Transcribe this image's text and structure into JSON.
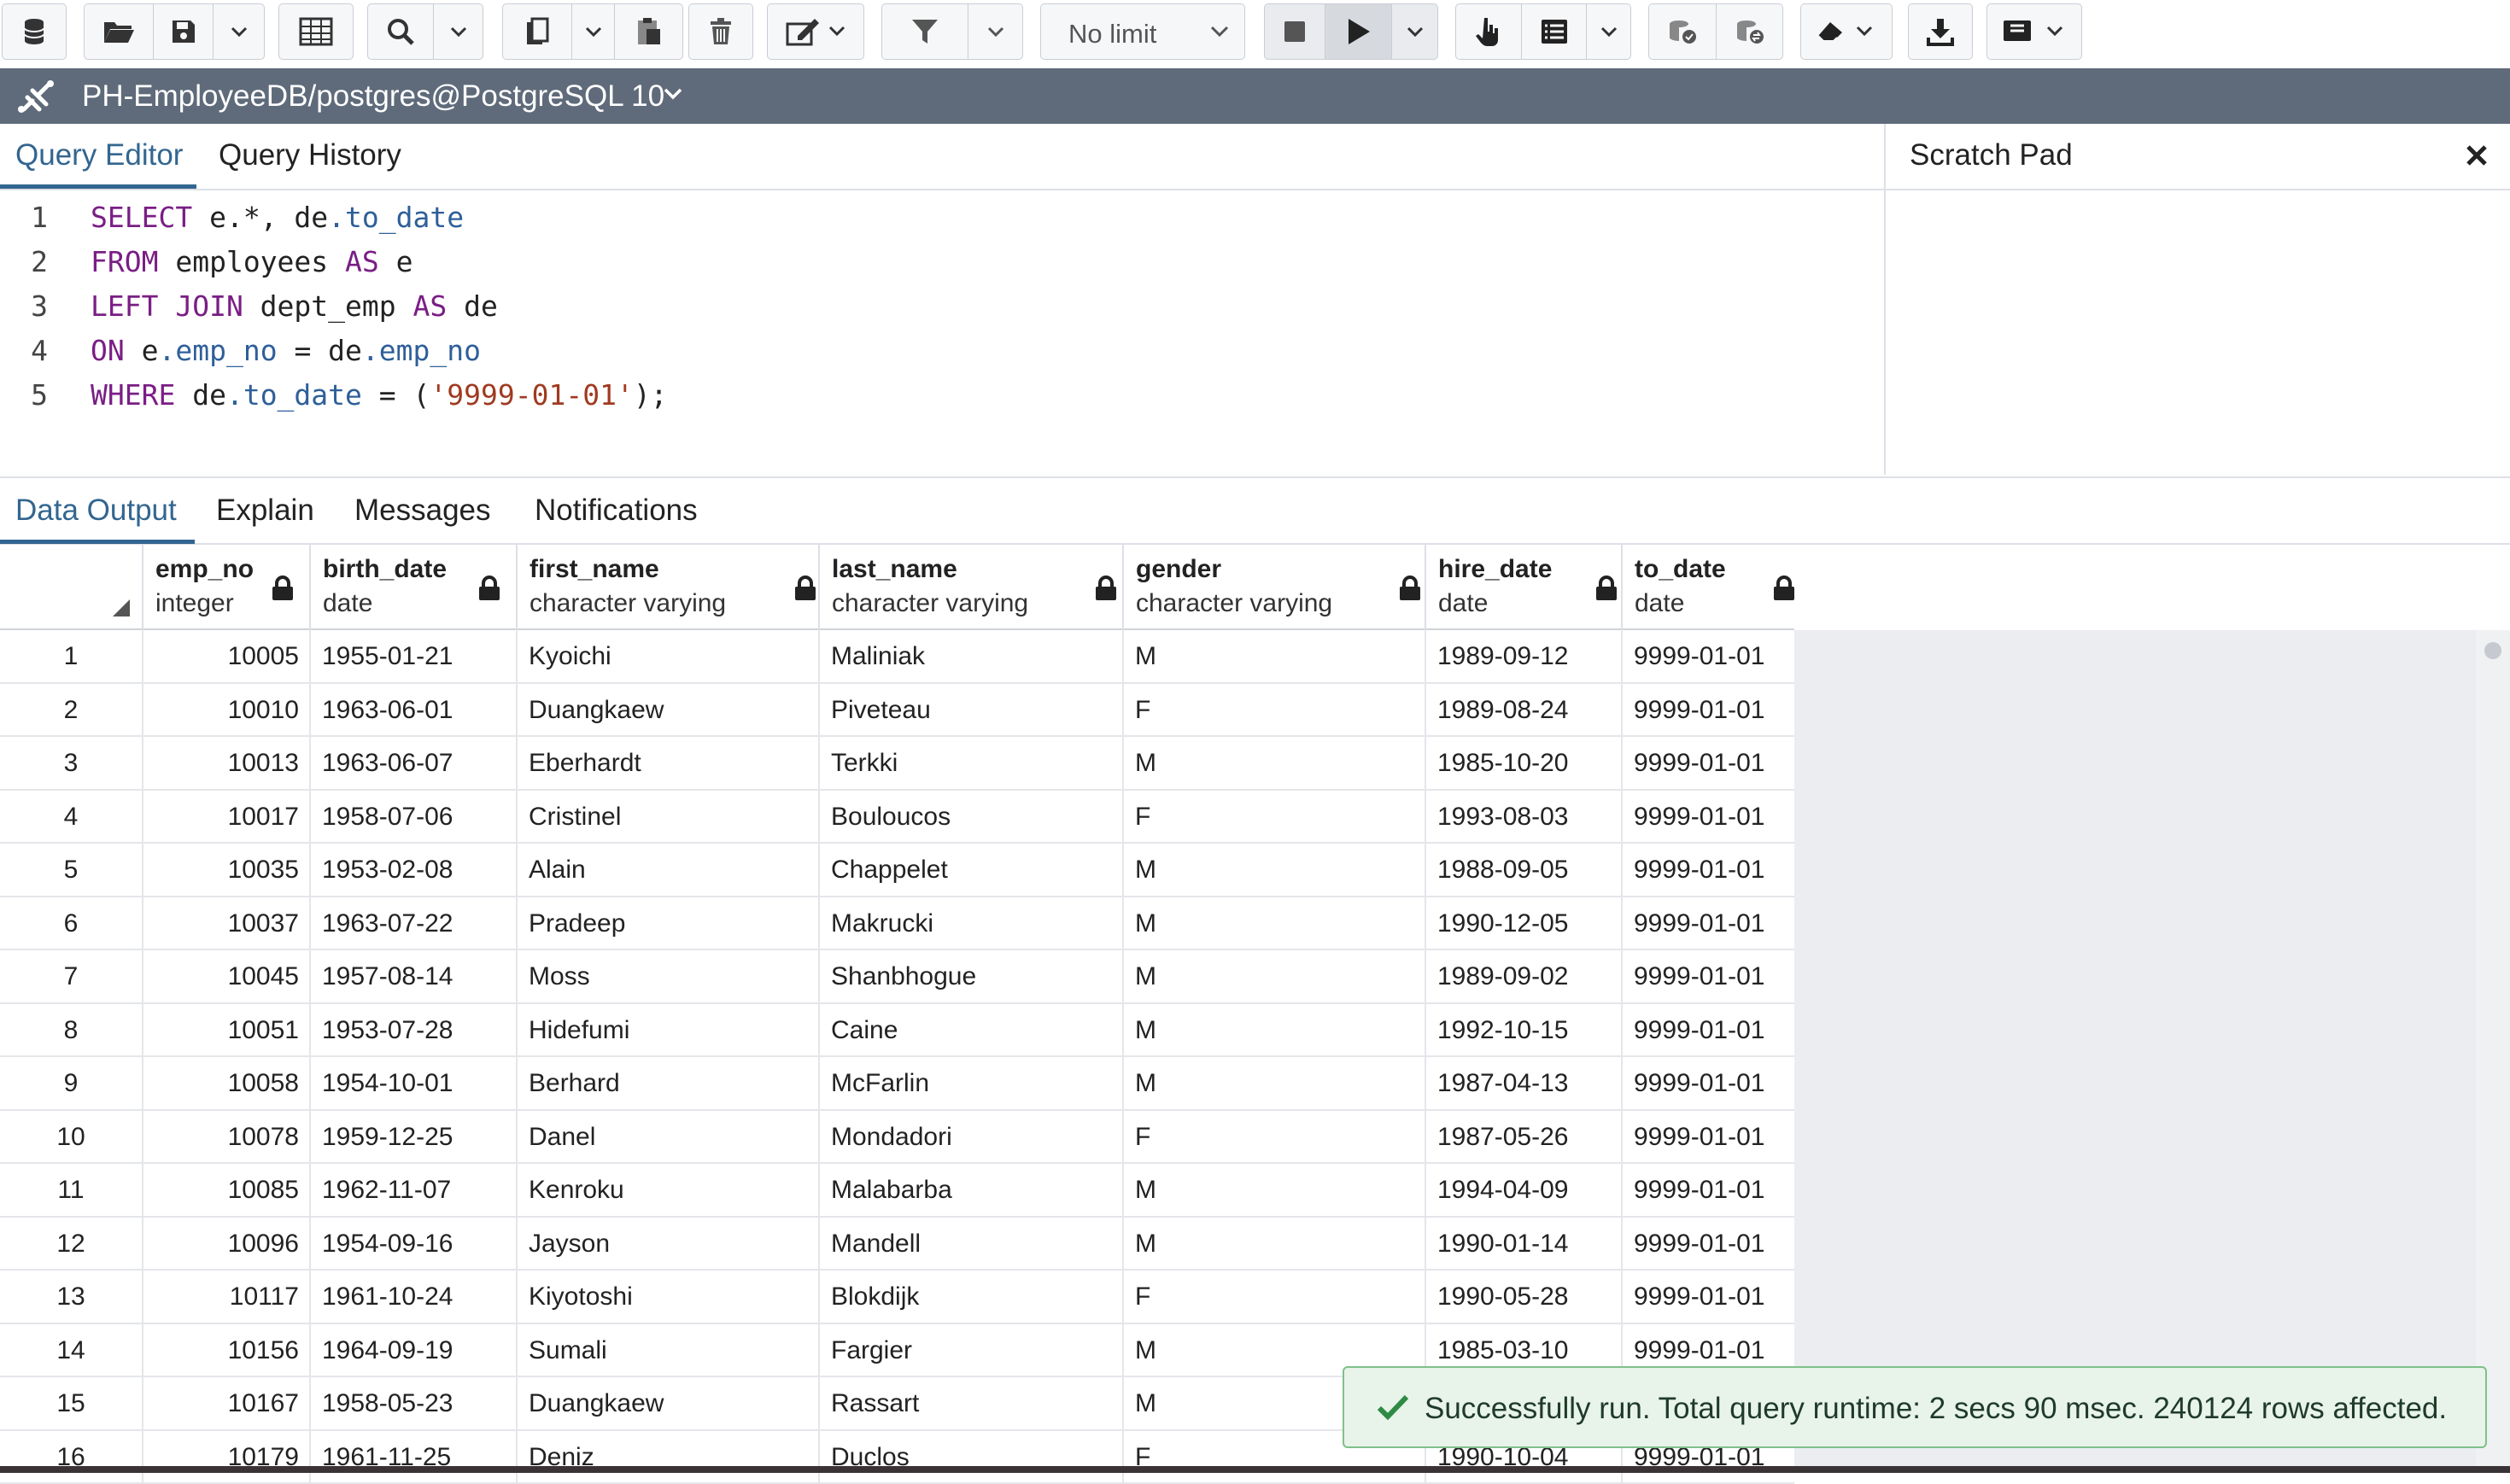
{
  "toolbar": {
    "buttons": [
      {
        "name": "database-icon"
      },
      {
        "name": "open-file-icon"
      },
      {
        "name": "save-icon"
      },
      {
        "name": "save-options-chevron-down-icon"
      },
      {
        "name": "edit-data-grid-icon"
      },
      {
        "name": "find-icon"
      },
      {
        "name": "find-options-chevron-down-icon"
      },
      {
        "name": "copy-icon"
      },
      {
        "name": "copy-options-chevron-down-icon"
      },
      {
        "name": "paste-icon"
      },
      {
        "name": "delete-icon"
      },
      {
        "name": "edit-pencil-icon"
      },
      {
        "name": "filter-icon"
      },
      {
        "name": "filter-options-chevron-down-icon"
      },
      {
        "name": "stop-icon"
      },
      {
        "name": "execute-play-icon"
      },
      {
        "name": "execute-options-chevron-down-icon"
      },
      {
        "name": "explain-hand-icon"
      },
      {
        "name": "explain-analyze-list-icon"
      },
      {
        "name": "explain-options-chevron-down-icon"
      },
      {
        "name": "commit-icon"
      },
      {
        "name": "rollback-icon"
      },
      {
        "name": "clear-eraser-icon"
      },
      {
        "name": "download-icon"
      },
      {
        "name": "macros-icon"
      }
    ],
    "limit_label": "No limit"
  },
  "connection": {
    "title": "PH-EmployeeDB/postgres@PostgreSQL 10"
  },
  "editor": {
    "tabs": [
      {
        "label": "Query Editor",
        "active": true
      },
      {
        "label": "Query History",
        "active": false
      }
    ],
    "lines": [
      {
        "number": "1",
        "tokens": [
          {
            "t": "SELECT",
            "k": "kw"
          },
          {
            "t": " e.*, de",
            "k": ""
          },
          {
            "t": ".to_date",
            "k": "prop"
          }
        ]
      },
      {
        "number": "2",
        "tokens": [
          {
            "t": "FROM",
            "k": "kw"
          },
          {
            "t": " employees ",
            "k": ""
          },
          {
            "t": "AS",
            "k": "kw"
          },
          {
            "t": " e",
            "k": ""
          }
        ]
      },
      {
        "number": "3",
        "tokens": [
          {
            "t": "LEFT JOIN",
            "k": "kw"
          },
          {
            "t": " dept_emp ",
            "k": ""
          },
          {
            "t": "AS",
            "k": "kw"
          },
          {
            "t": " de",
            "k": ""
          }
        ]
      },
      {
        "number": "4",
        "tokens": [
          {
            "t": "ON",
            "k": "kw"
          },
          {
            "t": " e",
            "k": ""
          },
          {
            "t": ".emp_no",
            "k": "prop"
          },
          {
            "t": " = de",
            "k": ""
          },
          {
            "t": ".emp_no",
            "k": "prop"
          }
        ]
      },
      {
        "number": "5",
        "tokens": [
          {
            "t": "WHERE",
            "k": "kw"
          },
          {
            "t": " de",
            "k": ""
          },
          {
            "t": ".to_date",
            "k": "prop"
          },
          {
            "t": " = (",
            "k": ""
          },
          {
            "t": "'9999-01-01'",
            "k": "str"
          },
          {
            "t": ");",
            "k": ""
          }
        ]
      }
    ]
  },
  "scratch_pad": {
    "title": "Scratch Pad"
  },
  "output": {
    "tabs": [
      {
        "label": "Data Output",
        "active": true
      },
      {
        "label": "Explain",
        "active": false
      },
      {
        "label": "Messages",
        "active": false
      },
      {
        "label": "Notifications",
        "active": false
      }
    ],
    "columns": [
      {
        "name": "emp_no",
        "type": "integer",
        "align": "num"
      },
      {
        "name": "birth_date",
        "type": "date",
        "align": "txt"
      },
      {
        "name": "first_name",
        "type": "character varying",
        "align": "txt"
      },
      {
        "name": "last_name",
        "type": "character varying",
        "align": "txt"
      },
      {
        "name": "gender",
        "type": "character varying",
        "align": "txt"
      },
      {
        "name": "hire_date",
        "type": "date",
        "align": "txt"
      },
      {
        "name": "to_date",
        "type": "date",
        "align": "txt"
      }
    ],
    "rows": [
      [
        "1",
        "10005",
        "1955-01-21",
        "Kyoichi",
        "Maliniak",
        "M",
        "1989-09-12",
        "9999-01-01"
      ],
      [
        "2",
        "10010",
        "1963-06-01",
        "Duangkaew",
        "Piveteau",
        "F",
        "1989-08-24",
        "9999-01-01"
      ],
      [
        "3",
        "10013",
        "1963-06-07",
        "Eberhardt",
        "Terkki",
        "M",
        "1985-10-20",
        "9999-01-01"
      ],
      [
        "4",
        "10017",
        "1958-07-06",
        "Cristinel",
        "Bouloucos",
        "F",
        "1993-08-03",
        "9999-01-01"
      ],
      [
        "5",
        "10035",
        "1953-02-08",
        "Alain",
        "Chappelet",
        "M",
        "1988-09-05",
        "9999-01-01"
      ],
      [
        "6",
        "10037",
        "1963-07-22",
        "Pradeep",
        "Makrucki",
        "M",
        "1990-12-05",
        "9999-01-01"
      ],
      [
        "7",
        "10045",
        "1957-08-14",
        "Moss",
        "Shanbhogue",
        "M",
        "1989-09-02",
        "9999-01-01"
      ],
      [
        "8",
        "10051",
        "1953-07-28",
        "Hidefumi",
        "Caine",
        "M",
        "1992-10-15",
        "9999-01-01"
      ],
      [
        "9",
        "10058",
        "1954-10-01",
        "Berhard",
        "McFarlin",
        "M",
        "1987-04-13",
        "9999-01-01"
      ],
      [
        "10",
        "10078",
        "1959-12-25",
        "Danel",
        "Mondadori",
        "F",
        "1987-05-26",
        "9999-01-01"
      ],
      [
        "11",
        "10085",
        "1962-11-07",
        "Kenroku",
        "Malabarba",
        "M",
        "1994-04-09",
        "9999-01-01"
      ],
      [
        "12",
        "10096",
        "1954-09-16",
        "Jayson",
        "Mandell",
        "M",
        "1990-01-14",
        "9999-01-01"
      ],
      [
        "13",
        "10117",
        "1961-10-24",
        "Kiyotoshi",
        "Blokdijk",
        "F",
        "1990-05-28",
        "9999-01-01"
      ],
      [
        "14",
        "10156",
        "1964-09-19",
        "Sumali",
        "Fargier",
        "M",
        "1985-03-10",
        "9999-01-01"
      ],
      [
        "15",
        "10167",
        "1958-05-23",
        "Duangkaew",
        "Rassart",
        "M",
        "",
        ""
      ],
      [
        "16",
        "10179",
        "1961-11-25",
        "Deniz",
        "Duclos",
        "F",
        "1990-10-04",
        "9999-01-01"
      ]
    ]
  },
  "toast": {
    "message": "Successfully run. Total query runtime: 2 secs 90 msec. 240124 rows affected."
  },
  "colors": {
    "accent": "#326690",
    "connection_bar": "#5f6b7a",
    "success_bg": "#e8f3ea",
    "success_icon": "#2e8b45"
  }
}
